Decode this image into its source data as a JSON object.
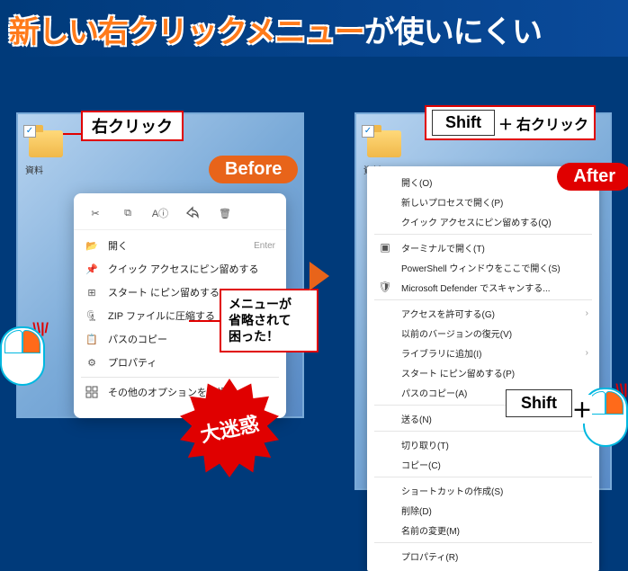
{
  "header": {
    "title_orange": "新しい右クリックメニュー",
    "title_white": "が使いにくい"
  },
  "labels": {
    "right_click": "右クリック",
    "shift": "Shift",
    "plus": "＋",
    "plus_right_click": "右クリック",
    "before": "Before",
    "after": "After",
    "callout_l1": "メニューが",
    "callout_l2": "省略されて",
    "callout_l3": "困った！",
    "starburst": "大迷惑",
    "folder_name": "資料"
  },
  "left_menu": {
    "top_icons": [
      "cut-icon",
      "copy-icon",
      "rename-icon",
      "share-icon",
      "delete-icon"
    ],
    "items": [
      {
        "icon": "open-icon",
        "label": "開く",
        "hint": "Enter"
      },
      {
        "icon": "pin-icon",
        "label": "クイック アクセスにピン留めする",
        "hint": ""
      },
      {
        "icon": "pin-start-icon",
        "label": "スタート にピン留めする",
        "hint": ""
      },
      {
        "icon": "zip-icon",
        "label": "ZIP ファイルに圧縮する",
        "hint": ""
      },
      {
        "icon": "path-icon",
        "label": "パスのコピー",
        "hint": ""
      },
      {
        "icon": "properties-icon",
        "label": "プロパティ",
        "hint": ""
      }
    ],
    "more": {
      "icon": "more-icon",
      "label": "その他のオプションを確認"
    }
  },
  "right_menu": {
    "groups": [
      [
        {
          "label": "開く(O)",
          "arrow": false
        },
        {
          "label": "新しいプロセスで開く(P)",
          "arrow": false
        },
        {
          "label": "クイック アクセスにピン留めする(Q)",
          "arrow": false
        }
      ],
      [
        {
          "label": "ターミナルで開く(T)",
          "icon": "terminal-icon",
          "arrow": false
        },
        {
          "label": "PowerShell ウィンドウをここで開く(S)",
          "arrow": false
        },
        {
          "label": "Microsoft Defender でスキャンする...",
          "icon": "shield-icon",
          "arrow": false
        }
      ],
      [
        {
          "label": "アクセスを許可する(G)",
          "arrow": true
        },
        {
          "label": "以前のバージョンの復元(V)",
          "arrow": false
        },
        {
          "label": "ライブラリに追加(I)",
          "arrow": true
        },
        {
          "label": "スタート にピン留めする(P)",
          "arrow": false
        },
        {
          "label": "パスのコピー(A)",
          "arrow": false
        }
      ],
      [
        {
          "label": "送る(N)",
          "arrow": true
        }
      ],
      [
        {
          "label": "切り取り(T)",
          "arrow": false
        },
        {
          "label": "コピー(C)",
          "arrow": false
        }
      ],
      [
        {
          "label": "ショートカットの作成(S)",
          "arrow": false
        },
        {
          "label": "削除(D)",
          "arrow": false
        },
        {
          "label": "名前の変更(M)",
          "arrow": false
        }
      ],
      [
        {
          "label": "プロパティ(R)",
          "arrow": false
        }
      ]
    ]
  }
}
